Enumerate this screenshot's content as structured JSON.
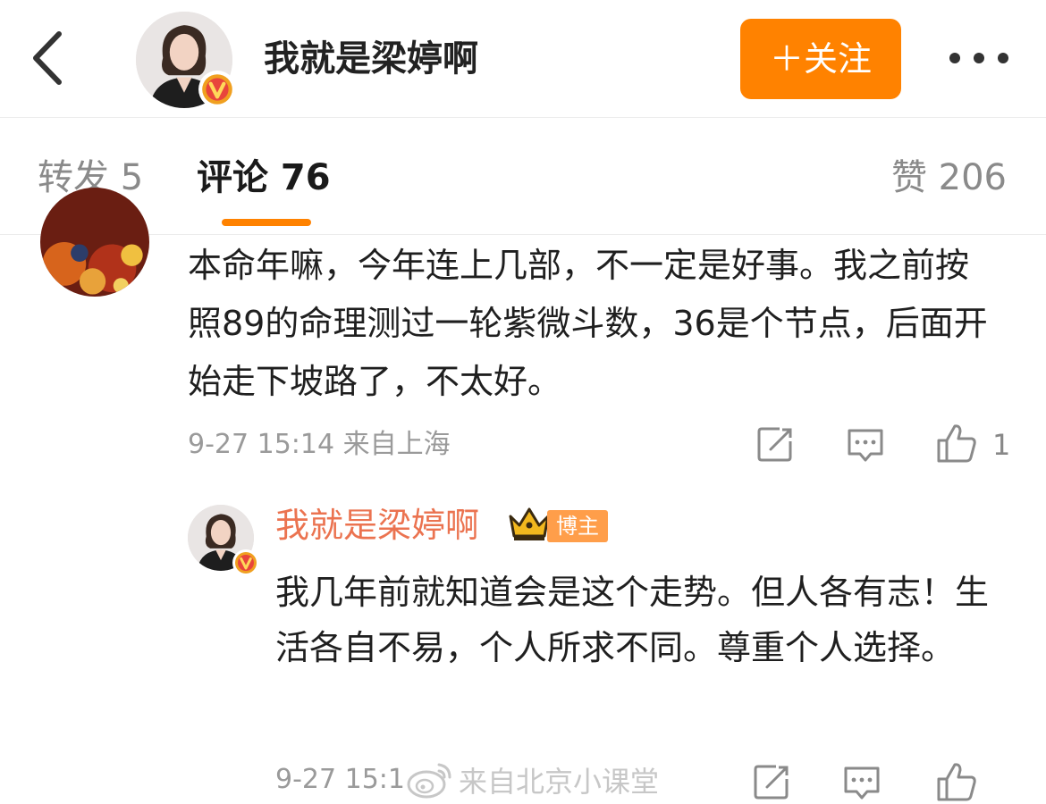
{
  "header": {
    "title": "我就是梁婷啊",
    "follow_label": "＋关注",
    "back_icon": "chevron-left-icon",
    "more_icon": "more-horizontal-icon",
    "verified_icon": "verified-v-icon"
  },
  "tabs": {
    "repost": "转发 5",
    "comments": "评论 76",
    "likes": "赞 206",
    "active": "comments"
  },
  "comment": {
    "text": "本命年嘛，今年连上几部，不一定是好事。我之前按照89的命理测过一轮紫微斗数，36是个节点，后面开始走下坡路了，不太好。",
    "meta": "9-27 15:14 来自上海",
    "like_count": "1",
    "icons": [
      "edit-icon",
      "comment-icon",
      "thumbs-up-icon"
    ]
  },
  "reply": {
    "author": "我就是梁婷啊",
    "role_badge": "博主",
    "text": "我几年前就知道会是这个走势。但人各有志！生活各自不易，个人所求不同。尊重个人选择。",
    "meta": "9-27 15:1",
    "icons": [
      "crown-icon",
      "edit-icon",
      "comment-icon",
      "thumbs-up-icon"
    ]
  },
  "watermark": {
    "text": "来自北京小课堂"
  },
  "colors": {
    "accent": "#ff8200",
    "author_name": "#eb7350",
    "host_badge": "#ff9e4a",
    "verified_badge": "#f0a020",
    "text_primary": "#1f1f1f",
    "text_secondary": "#9a9a9a"
  }
}
